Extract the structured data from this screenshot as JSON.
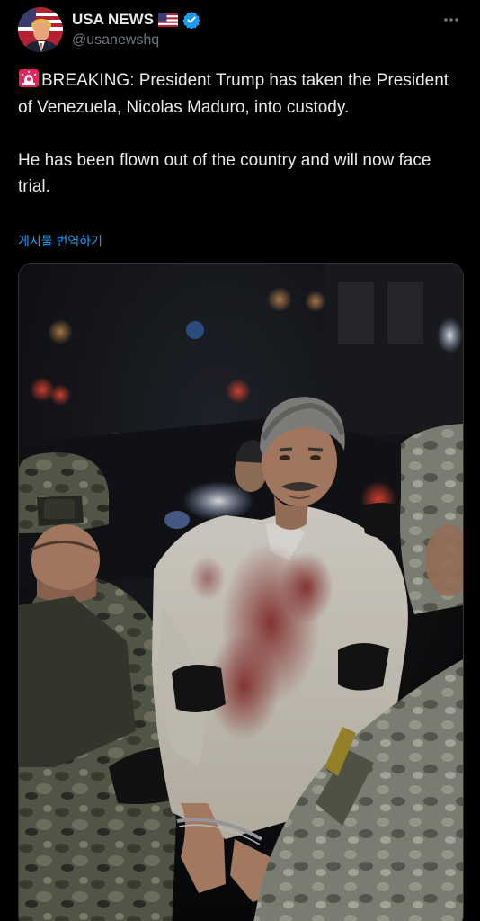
{
  "account": {
    "display_name": "USA NEWS",
    "handle": "@usanewshq"
  },
  "icons": {
    "avatar": "trump-portrait-avatar",
    "flag": "us-flag-icon",
    "verified": "verified-badge-icon",
    "more": "more-options-icon",
    "siren": "rotating-light-emoji"
  },
  "post": {
    "paragraph1": "BREAKING: President Trump has taken the President of Venezuela, Nicolas Maduro, into custody.",
    "paragraph2": "He has been flown out of the country and will now face trial.",
    "translate_label": "게시물 번역하기"
  },
  "colors": {
    "background": "#000000",
    "text": "#e7e9ea",
    "secondary_text": "#71767b",
    "link": "#1d9bf0",
    "verified": "#1d9bf0"
  }
}
